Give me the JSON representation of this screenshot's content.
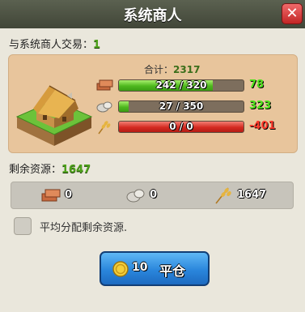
{
  "dialog": {
    "title": "系统商人",
    "close_label": "✕"
  },
  "trade": {
    "label": "与系统商人交易：",
    "count": "1"
  },
  "summary": {
    "total_label": "合计：",
    "total_value": "2317"
  },
  "resources": [
    {
      "name": "brick",
      "icon": "brick-icon",
      "bar_text": "242 / 320",
      "fill": 0.756,
      "fill_color": "green",
      "delta": "78",
      "delta_color": "green"
    },
    {
      "name": "stone",
      "icon": "stone-icon",
      "bar_text": "27 / 350",
      "fill": 0.077,
      "fill_color": "green",
      "delta": "323",
      "delta_color": "green"
    },
    {
      "name": "wheat",
      "icon": "wheat-icon",
      "bar_text": "0 / 0",
      "fill": 1.0,
      "fill_color": "red",
      "delta": "-401",
      "delta_color": "red"
    }
  ],
  "remaining": {
    "label": "剩余资源：",
    "value": "1647"
  },
  "remaining_breakdown": [
    {
      "icon": "brick-icon",
      "value": "0"
    },
    {
      "icon": "stone-icon",
      "value": "0"
    },
    {
      "icon": "wheat-icon",
      "value": "1647"
    }
  ],
  "option": {
    "label": "平均分配剩余资源.",
    "checked": false
  },
  "balance_button": {
    "cost": "10",
    "label": "平仓",
    "icon": "gold-coin-icon"
  },
  "colors": {
    "title_bar": "#4d5243",
    "panel": "#e8c59c",
    "button": "#2a86dc",
    "green": "#4ee21c",
    "red": "#ff3a2b"
  }
}
